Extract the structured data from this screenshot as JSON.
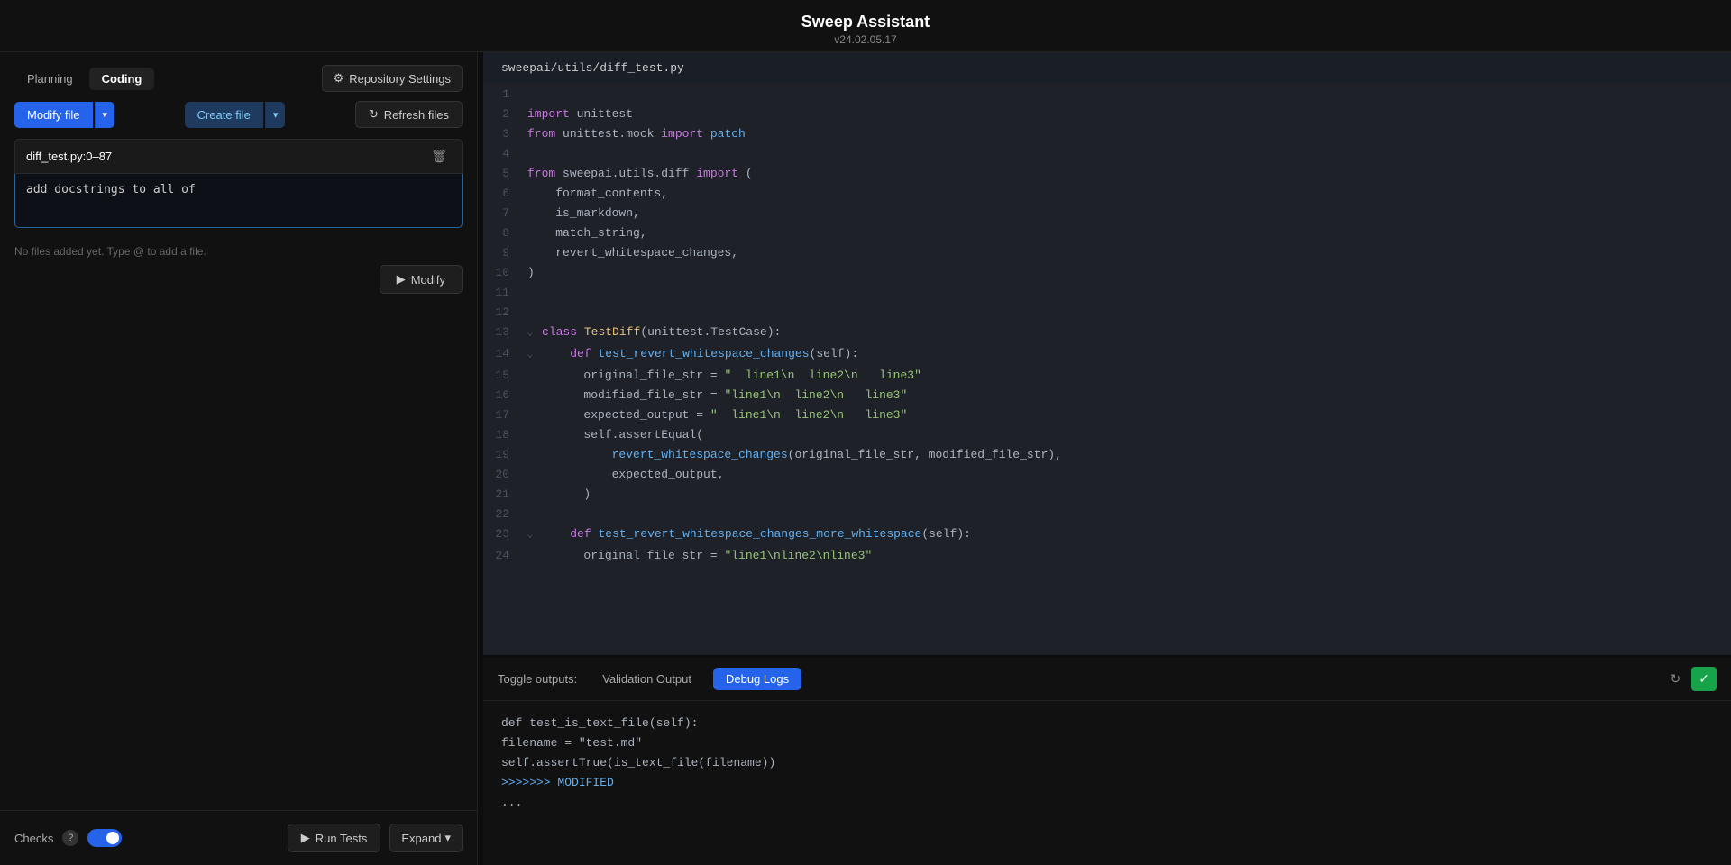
{
  "app": {
    "title": "Sweep Assistant",
    "version": "v24.02.05.17"
  },
  "left_panel": {
    "tabs": [
      {
        "id": "planning",
        "label": "Planning",
        "active": false
      },
      {
        "id": "coding",
        "label": "Coding",
        "active": true
      }
    ],
    "repo_settings_btn": "Repository Settings",
    "modify_file_btn": "Modify file",
    "create_file_btn": "Create file",
    "refresh_files_btn": "Refresh files",
    "file_entry": {
      "name": "diff_test.py:0–87",
      "instruction": "add docstrings to all of "
    },
    "hint": "No files added yet. Type @ to add a file.",
    "modify_btn": "Modify",
    "checks_label": "Checks",
    "run_tests_btn": "Run Tests",
    "expand_btn": "Expand"
  },
  "code_panel": {
    "file_path": "sweepai/utils/diff_test.py",
    "lines": [
      {
        "num": 1,
        "content": ""
      },
      {
        "num": 2,
        "tokens": [
          {
            "t": "import ",
            "c": "kw"
          },
          {
            "t": "unittest",
            "c": ""
          }
        ]
      },
      {
        "num": 3,
        "tokens": [
          {
            "t": "from ",
            "c": "kw"
          },
          {
            "t": "unittest.mock ",
            "c": ""
          },
          {
            "t": "import ",
            "c": "kw"
          },
          {
            "t": "patch",
            "c": "fn"
          }
        ]
      },
      {
        "num": 4,
        "content": ""
      },
      {
        "num": 5,
        "tokens": [
          {
            "t": "from ",
            "c": "kw"
          },
          {
            "t": "sweepai.utils.diff ",
            "c": ""
          },
          {
            "t": "import ",
            "c": "kw"
          },
          {
            "t": "(",
            "c": "pn"
          }
        ]
      },
      {
        "num": 6,
        "tokens": [
          {
            "t": "    format_contents,",
            "c": ""
          }
        ]
      },
      {
        "num": 7,
        "tokens": [
          {
            "t": "    is_markdown,",
            "c": ""
          }
        ]
      },
      {
        "num": 8,
        "tokens": [
          {
            "t": "    match_string,",
            "c": ""
          }
        ]
      },
      {
        "num": 9,
        "tokens": [
          {
            "t": "    revert_whitespace_changes,",
            "c": ""
          }
        ]
      },
      {
        "num": 10,
        "tokens": [
          {
            "t": ")",
            "c": "pn"
          }
        ]
      },
      {
        "num": 11,
        "content": ""
      },
      {
        "num": 12,
        "content": ""
      },
      {
        "num": 13,
        "tokens": [
          {
            "t": "class ",
            "c": "kw"
          },
          {
            "t": "TestDiff",
            "c": "cl"
          },
          {
            "t": "(unittest.TestCase):",
            "c": ""
          }
        ],
        "fold": true
      },
      {
        "num": 14,
        "tokens": [
          {
            "t": "    ",
            "c": ""
          },
          {
            "t": "def ",
            "c": "kw"
          },
          {
            "t": "test_revert_whitespace_changes",
            "c": "fn"
          },
          {
            "t": "(self):",
            "c": "pn"
          }
        ],
        "fold": true
      },
      {
        "num": 15,
        "tokens": [
          {
            "t": "        original_file_str = ",
            "c": ""
          },
          {
            "t": "\"  line1\\n  line2\\n   line3\"",
            "c": "st"
          }
        ]
      },
      {
        "num": 16,
        "tokens": [
          {
            "t": "        modified_file_str = ",
            "c": ""
          },
          {
            "t": "\"line1\\n  line2\\n   line3\"",
            "c": "st"
          }
        ]
      },
      {
        "num": 17,
        "tokens": [
          {
            "t": "        expected_output = ",
            "c": ""
          },
          {
            "t": "\"  line1\\n  line2\\n   line3\"",
            "c": "st"
          }
        ]
      },
      {
        "num": 18,
        "tokens": [
          {
            "t": "        self.assertEqual(",
            "c": ""
          }
        ]
      },
      {
        "num": 19,
        "tokens": [
          {
            "t": "            revert_whitespace_changes",
            "c": "fn"
          },
          {
            "t": "(original_file_str, modified_file_str),",
            "c": ""
          }
        ]
      },
      {
        "num": 20,
        "tokens": [
          {
            "t": "            expected_output,",
            "c": ""
          }
        ]
      },
      {
        "num": 21,
        "tokens": [
          {
            "t": "        )",
            "c": "pn"
          }
        ]
      },
      {
        "num": 22,
        "content": ""
      },
      {
        "num": 23,
        "tokens": [
          {
            "t": "    ",
            "c": ""
          },
          {
            "t": "def ",
            "c": "kw"
          },
          {
            "t": "test_revert_whitespace_changes_more_whitespace",
            "c": "fn"
          },
          {
            "t": "(self):",
            "c": "pn"
          }
        ],
        "fold": true
      },
      {
        "num": 24,
        "tokens": [
          {
            "t": "        original_file_str = ",
            "c": ""
          },
          {
            "t": "\"line1\\nline2\\nline3\"",
            "c": "st"
          }
        ]
      }
    ]
  },
  "output_panel": {
    "toggle_label": "Toggle outputs:",
    "tabs": [
      {
        "id": "validation",
        "label": "Validation Output",
        "active": false
      },
      {
        "id": "debug",
        "label": "Debug Logs",
        "active": true
      }
    ],
    "content": [
      "def test_is_text_file(self):",
      "    filename = \"test.md\"",
      "    self.assertTrue(is_text_file(filename))",
      ">>>>>>> MODIFIED",
      "..."
    ]
  }
}
